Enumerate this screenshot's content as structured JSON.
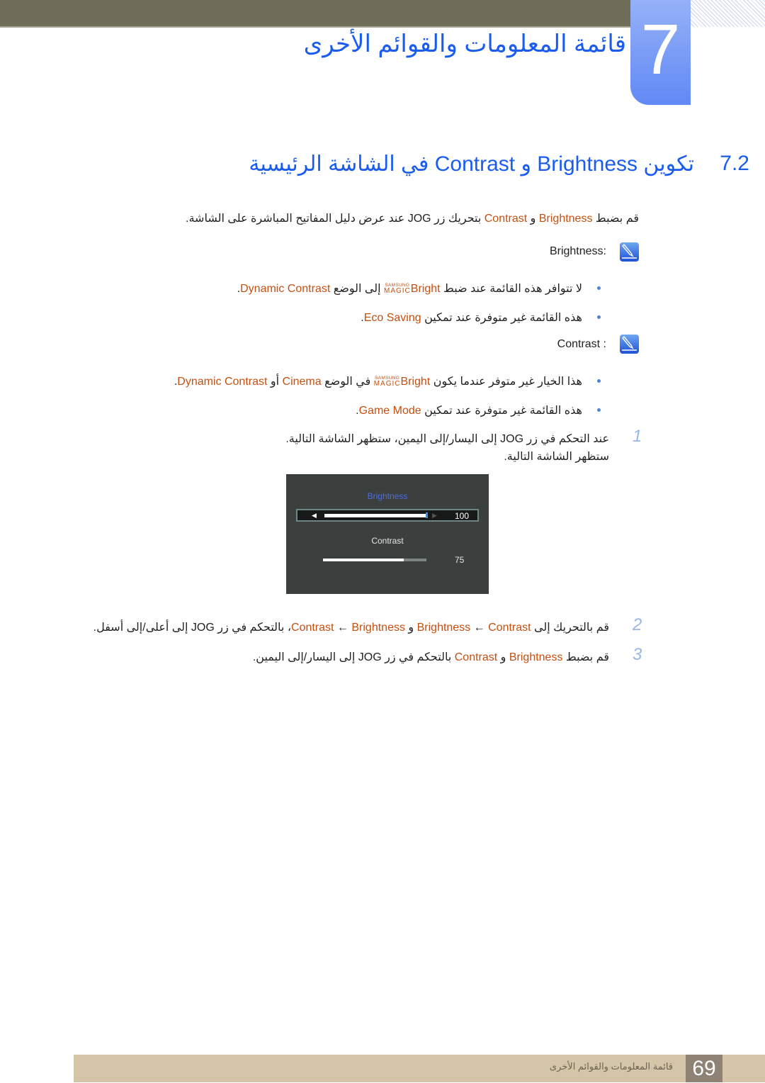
{
  "header": {
    "chapter_number": "7",
    "chapter_title": "قائمة المعلومات والقوائم الأخرى"
  },
  "section": {
    "number": "7.2",
    "title_prefix": "تكوين",
    "term_brightness": "Brightness",
    "conj": "و",
    "term_contrast": "Contrast",
    "title_suffix": "في الشاشة الرئيسية"
  },
  "intro": {
    "p1": "قم بضبط",
    "brightness": "Brightness",
    "and": "و",
    "contrast": "Contrast",
    "p2": "بتحريك زر JOG عند عرض دليل المفاتيح المباشرة على الشاشة."
  },
  "notes": [
    {
      "icon": "note-pencil-icon",
      "label": "Brightness",
      "prefix": ":",
      "bullets": [
        {
          "pre": "لا تتوافر هذه القائمة عند ضبط",
          "magic": {
            "samsung": "SAMSUNG",
            "magic": "MAGIC",
            "bright": "Bright"
          },
          "mid": "إلى الوضع",
          "term": "Dynamic Contrast",
          "end": "."
        },
        {
          "pre": "هذه القائمة غير متوفرة عند تمكين",
          "term": "Eco Saving",
          "end": "."
        }
      ]
    },
    {
      "icon": "note-pencil-icon",
      "label": "Contrast",
      "prefix": ": ",
      "bullets": [
        {
          "pre": "هذا الخيار غير متوفر عندما يكون",
          "magic": {
            "samsung": "SAMSUNG",
            "magic": "MAGIC",
            "bright": "Bright"
          },
          "mid": "في الوضع",
          "term1": "Cinema",
          "or": "أو",
          "term2": "Dynamic Contrast",
          "end": "."
        },
        {
          "pre": "هذه القائمة غير متوفرة عند تمكين",
          "term": "Game Mode",
          "end": "."
        }
      ]
    }
  ],
  "steps": [
    {
      "number": "1",
      "line1": "عند التحكم في زر JOG إلى اليسار/إلى اليمين، ستظهر الشاشة التالية.",
      "line2": "ستظهر الشاشة التالية."
    },
    {
      "number": "2",
      "pre": "قم بالتحريك إلى",
      "t1": "Brightness",
      "arrow1": "←",
      "t2": "Contrast",
      "and": "و",
      "t3": "Contrast",
      "arrow2": "←",
      "t4": "Brightness",
      "post": "، بالتحكم في زر JOG إلى أعلى/إلى أسفل."
    },
    {
      "number": "3",
      "pre": "قم بضبط",
      "t1": "Brightness",
      "and": "و",
      "t2": "Contrast",
      "post": "بالتحكم في زر JOG إلى اليسار/إلى اليمين."
    }
  ],
  "osd": {
    "brightness_label": "Brightness",
    "brightness_value": "100",
    "brightness_level": 1.0,
    "left_arrow": "◀",
    "right_arrow": "▶",
    "contrast_label": "Contrast",
    "contrast_value": "75",
    "contrast_level": 0.78
  },
  "footer": {
    "title": "قائمة المعلومات والقوائم الأخرى",
    "page_number": "69"
  },
  "colors": {
    "accent_blue": "#1a5cf0",
    "term_orange": "#c64f10",
    "step_number": "#98b6ec"
  }
}
